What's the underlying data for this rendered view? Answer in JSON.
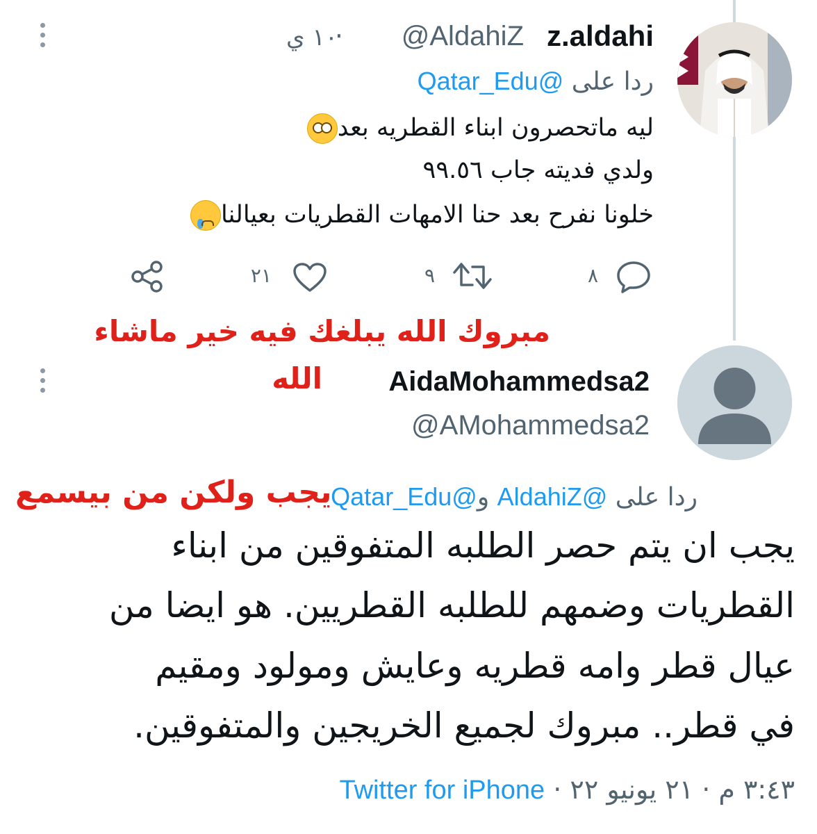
{
  "tweet1": {
    "display_name": "z.aldahi",
    "handle": "@AldahiZ",
    "separator": "·",
    "time": "١٠ ي",
    "reply_prefix": "ردا على",
    "reply_to": "@Qatar_Edu",
    "lines": [
      "ليه ماتحصرون ابناء القطريه بعد",
      "ولدي فديته جاب ٩٩.٥٦",
      "خلونا نفرح بعد حنا الامهات القطريات بعيالنا"
    ],
    "emoji_line1": "face-with-rolling-eyes",
    "emoji_line3": "crying-face",
    "counts": {
      "replies": "٨",
      "retweets": "٩",
      "likes": "٢١"
    },
    "icons": {
      "reply": "reply-icon",
      "retweet": "retweet-icon",
      "like": "heart-icon",
      "share": "share-icon"
    }
  },
  "annotation_top": {
    "line1": "مبروك الله يبلغك فيه خير ماشاء",
    "line2": "الله",
    "color": "#e0211a"
  },
  "tweet2": {
    "display_name": "AidaMohammedsa2",
    "handle": "@AMohammedsa2",
    "reply_prefix": "ردا على",
    "reply_to_1": "@AldahiZ",
    "reply_joiner": "و",
    "reply_to_2": "@Qatar_Edu",
    "annotation": "يجب ولكن من بيسمع",
    "lines": [
      "يجب ان يتم حصر الطلبه المتفوقين من ابناء",
      "القطريات وضمهم للطلبه القطريين. هو ايضا من",
      "عيال قطر وامه قطريه وعايش ومولود ومقيم",
      "في قطر.. مبروك لجميع الخريجين والمتفوقين."
    ],
    "timestamp": "٣:٤٣ م · ٢١ يونيو ٢٢ ·",
    "source": "Twitter for iPhone"
  },
  "colors": {
    "link": "#1d9bf0",
    "muted": "#536471",
    "text": "#0f1419",
    "annotation": "#e0211a"
  }
}
